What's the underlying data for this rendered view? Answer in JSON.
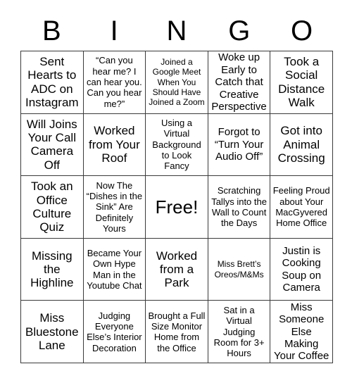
{
  "card": {
    "header_letters": [
      "B",
      "I",
      "N",
      "G",
      "O"
    ],
    "free_space_label": "Free!",
    "border_color": "#3a3a3a",
    "background_color": "#ffffff",
    "text_color": "#000000",
    "grid_size": "5x5"
  },
  "cells": [
    {
      "row": 1,
      "col": 1,
      "text": "Sent Hearts to ADC on Instagram",
      "size": "lg"
    },
    {
      "row": 1,
      "col": 2,
      "text": "“Can you hear me? I can hear you. Can you hear me?”",
      "size": "sm"
    },
    {
      "row": 1,
      "col": 3,
      "text": "Joined a Google Meet When You Should Have Joined a Zoom",
      "size": "xs"
    },
    {
      "row": 1,
      "col": 4,
      "text": "Woke up Early to Catch that Creative Perspective",
      "size": "md"
    },
    {
      "row": 1,
      "col": 5,
      "text": "Took a Social Distance Walk",
      "size": "lg"
    },
    {
      "row": 2,
      "col": 1,
      "text": "Will Joins Your Call Camera Off",
      "size": "lg"
    },
    {
      "row": 2,
      "col": 2,
      "text": "Worked from Your Roof",
      "size": "lg"
    },
    {
      "row": 2,
      "col": 3,
      "text": "Using a Virtual Background to Look Fancy",
      "size": "sm"
    },
    {
      "row": 2,
      "col": 4,
      "text": "Forgot to “Turn Your Audio Off”",
      "size": "md"
    },
    {
      "row": 2,
      "col": 5,
      "text": "Got into Animal Crossing",
      "size": "lg"
    },
    {
      "row": 3,
      "col": 1,
      "text": "Took an Office Culture Quiz",
      "size": "lg"
    },
    {
      "row": 3,
      "col": 2,
      "text": "Now The “Dishes in the Sink” Are Definitely Yours",
      "size": "sm"
    },
    {
      "row": 3,
      "col": 3,
      "text": "Free!",
      "size": "xl",
      "free_space": true
    },
    {
      "row": 3,
      "col": 4,
      "text": "Scratching Tallys into the Wall to Count the Days",
      "size": "sm"
    },
    {
      "row": 3,
      "col": 5,
      "text": "Feeling Proud about Your MacGyvered Home Office",
      "size": "sm"
    },
    {
      "row": 4,
      "col": 1,
      "text": "Missing the Highline",
      "size": "lg"
    },
    {
      "row": 4,
      "col": 2,
      "text": "Became Your Own Hype Man in the Youtube Chat",
      "size": "sm"
    },
    {
      "row": 4,
      "col": 3,
      "text": "Worked from a Park",
      "size": "lg"
    },
    {
      "row": 4,
      "col": 4,
      "text": "Miss Brett’s Oreos/M&Ms",
      "size": "xs"
    },
    {
      "row": 4,
      "col": 5,
      "text": "Justin is Cooking Soup on Camera",
      "size": "md"
    },
    {
      "row": 5,
      "col": 1,
      "text": "Miss Bluestone Lane",
      "size": "lg"
    },
    {
      "row": 5,
      "col": 2,
      "text": "Judging Everyone Else’s Interior Decoration",
      "size": "sm"
    },
    {
      "row": 5,
      "col": 3,
      "text": "Brought a Full Size Monitor Home from the Office",
      "size": "sm"
    },
    {
      "row": 5,
      "col": 4,
      "text": "Sat in a Virtual Judging Room for 3+ Hours",
      "size": "sm"
    },
    {
      "row": 5,
      "col": 5,
      "text": "Miss Someone Else Making Your Coffee",
      "size": "md"
    }
  ]
}
